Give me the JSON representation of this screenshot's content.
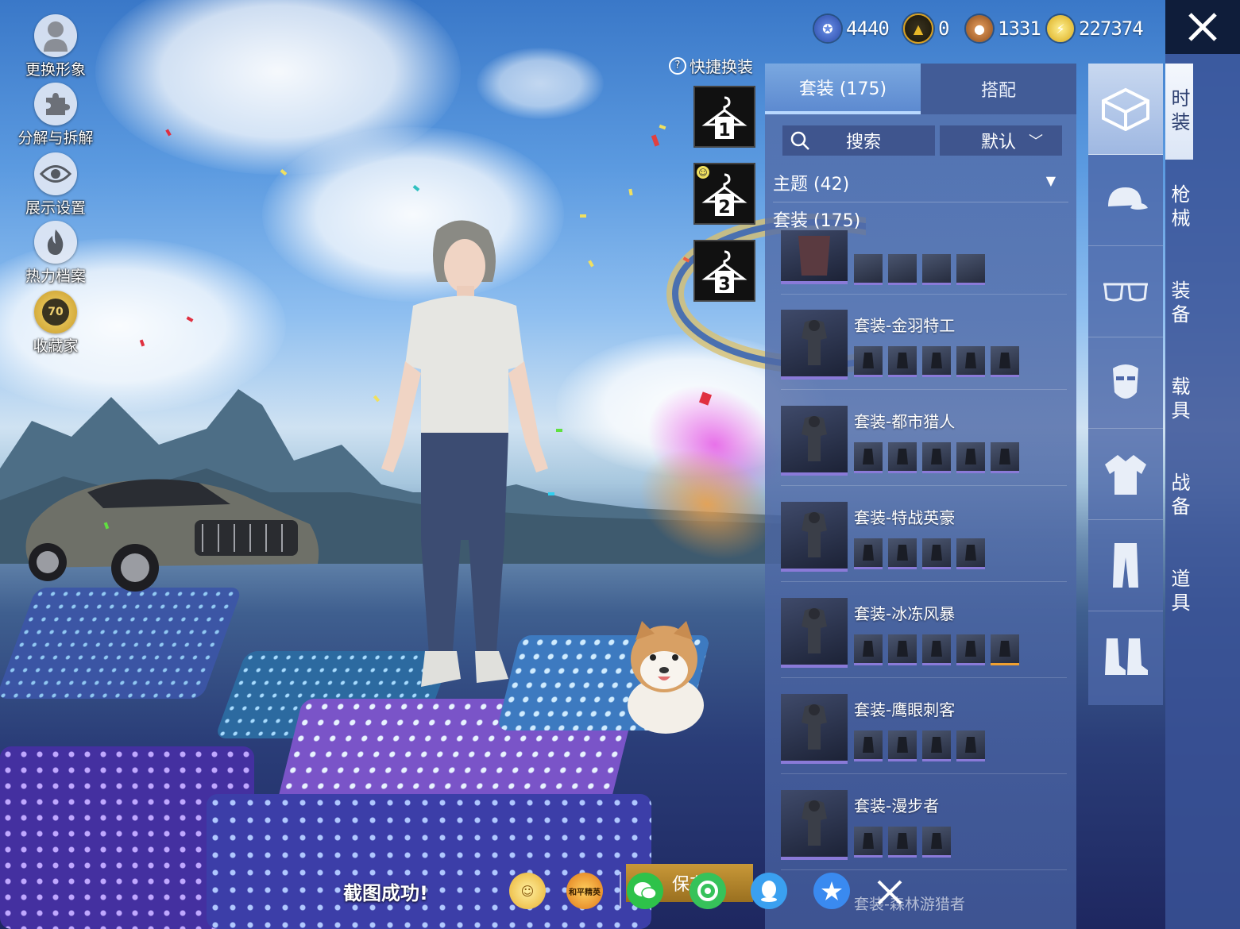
{
  "left_menu": [
    {
      "label": "更换形象",
      "icon": "avatar-icon"
    },
    {
      "label": "分解与拆解",
      "icon": "puzzle-icon"
    },
    {
      "label": "展示设置",
      "icon": "eye-icon"
    },
    {
      "label": "热力档案",
      "icon": "flame-icon"
    },
    {
      "label": "收藏家",
      "icon": "collector-badge-icon",
      "badge": "70"
    }
  ],
  "currencies": [
    {
      "icon": "blue-coin-icon",
      "amount": "4440",
      "color": "#3a64c8"
    },
    {
      "icon": "gold-triangle-coin-icon",
      "amount": "0",
      "color": "#d8a020"
    },
    {
      "icon": "bronze-coin-icon",
      "amount": "1331",
      "color": "#b8702a"
    },
    {
      "icon": "lightning-coin-icon",
      "amount": "227374",
      "color": "#e8c030"
    }
  ],
  "quick_change": {
    "label": "快捷换装",
    "slots": [
      "1",
      "2",
      "3"
    ]
  },
  "panel": {
    "tabs": [
      {
        "label": "套装 (175)",
        "active": true
      },
      {
        "label": "搭配",
        "active": false
      }
    ],
    "search_label": "搜索",
    "sort_label": "默认",
    "theme_row": "主题 (42)",
    "suits_row": "套装 (175)",
    "suits": [
      {
        "name": "套装-金羽特工",
        "items": 5
      },
      {
        "name": "套装-都市猎人",
        "items": 5
      },
      {
        "name": "套装-特战英豪",
        "items": 4
      },
      {
        "name": "套装-冰冻风暴",
        "items": 5
      },
      {
        "name": "套装-鹰眼刺客",
        "items": 4
      },
      {
        "name": "套装-漫步者",
        "items": 3
      }
    ],
    "partial_bottom_suit": "套装-森林游猎者"
  },
  "icon_column": [
    "outfit-box-icon",
    "cap-icon",
    "glasses-icon",
    "mask-icon",
    "shirt-icon",
    "pants-icon",
    "boots-icon"
  ],
  "categories": [
    {
      "label": "时装",
      "active": true
    },
    {
      "label": "枪械",
      "active": false
    },
    {
      "label": "装备",
      "active": false
    },
    {
      "label": "载具",
      "active": false
    },
    {
      "label": "战备",
      "active": false
    },
    {
      "label": "道具",
      "active": false
    }
  ],
  "bottom_bar": {
    "screenshot_msg": "截图成功!",
    "save_label": "保存",
    "share_targets": [
      {
        "icon": "game-friends-icon",
        "color": "#f0c040"
      },
      {
        "icon": "peacekeeper-elite-icon",
        "color": "#f2a020",
        "text": "和平精英"
      },
      {
        "icon": "wechat-icon",
        "color": "#2ec24a"
      },
      {
        "icon": "moments-icon",
        "color": "#36c25a"
      },
      {
        "icon": "qq-icon",
        "color": "#3aa0f0"
      },
      {
        "icon": "qzone-icon",
        "color": "#3a8af0"
      }
    ]
  }
}
